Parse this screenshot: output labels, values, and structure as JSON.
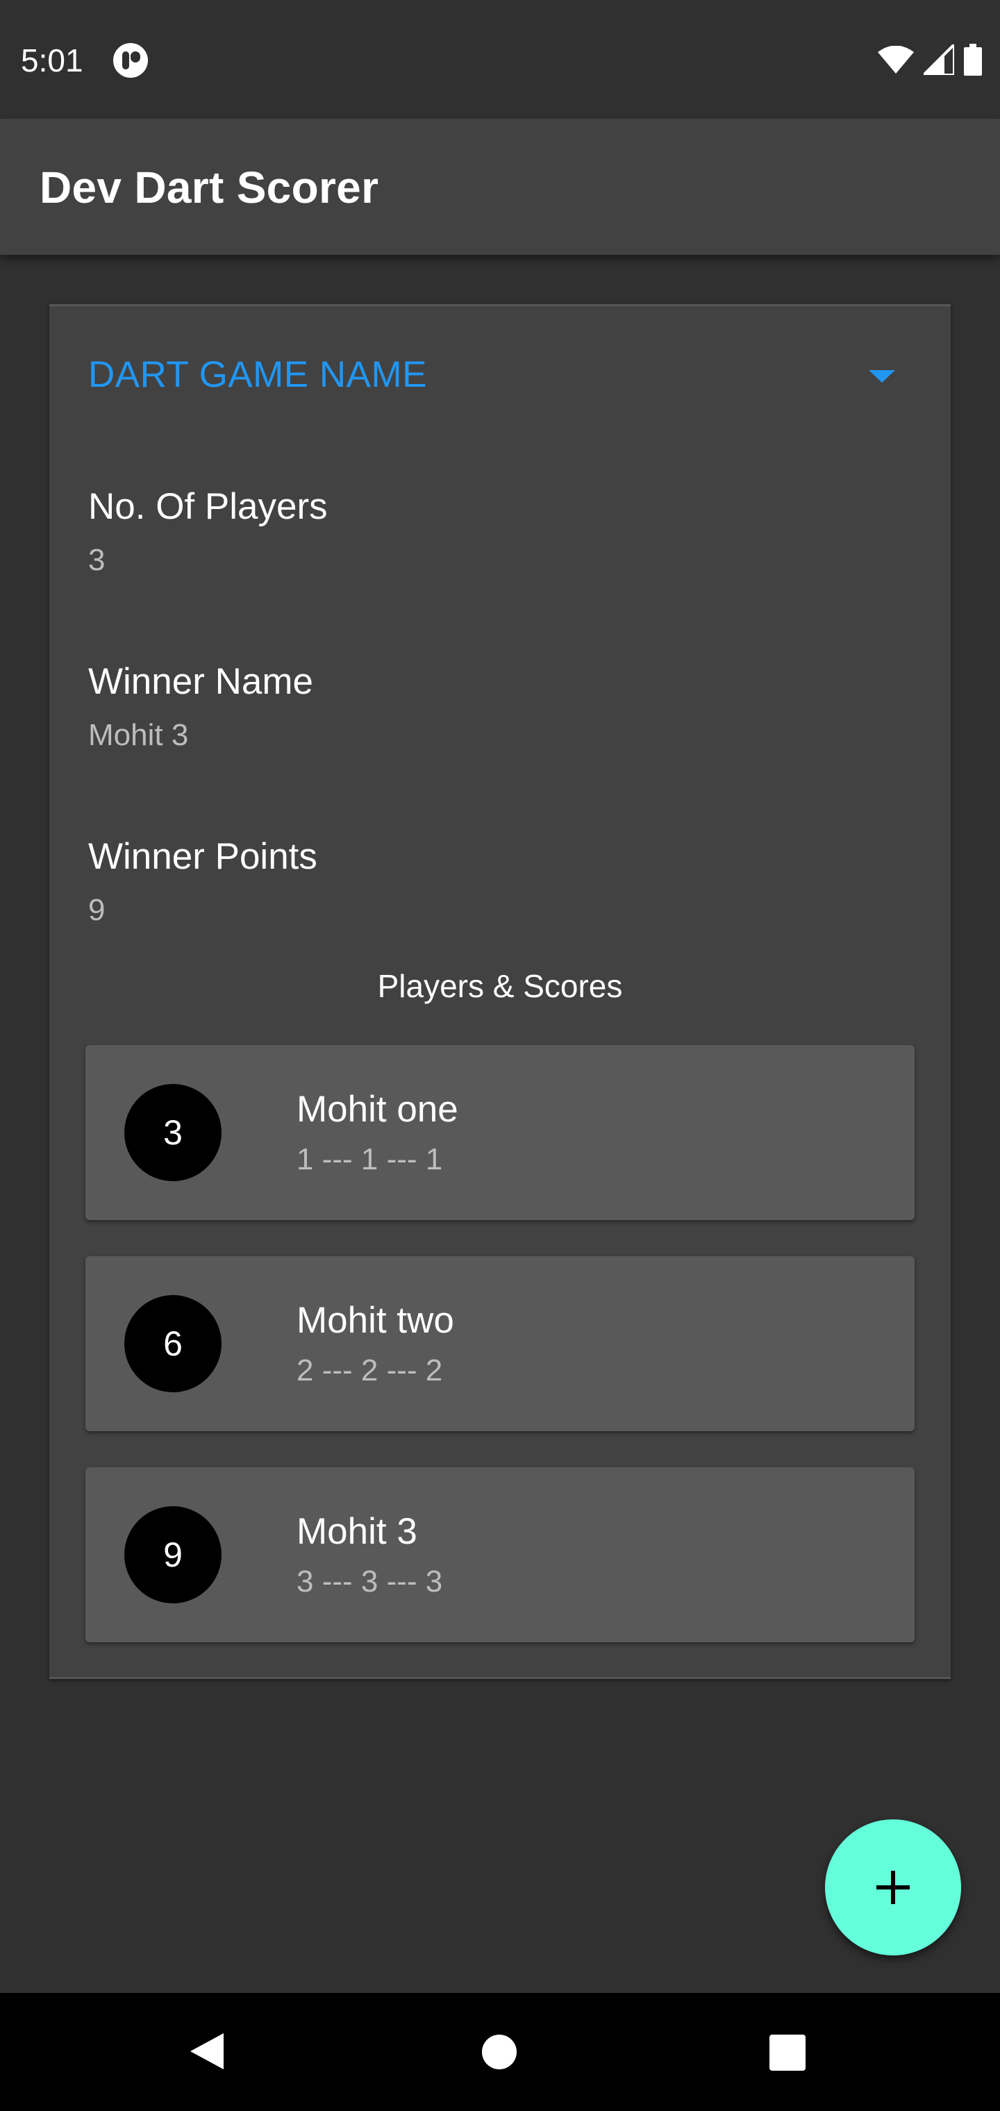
{
  "status_bar": {
    "time": "5:01"
  },
  "app_bar": {
    "title": "Dev Dart Scorer"
  },
  "game": {
    "panel_title": "DART GAME NAME",
    "players_count_label": "No. Of Players",
    "players_count_value": "3",
    "winner_name_label": "Winner Name",
    "winner_name_value": "Mohit 3",
    "winner_points_label": "Winner Points",
    "winner_points_value": "9",
    "players_heading": "Players & Scores",
    "players": [
      {
        "total": "3",
        "name": "Mohit one",
        "scores": "1 --- 1 --- 1"
      },
      {
        "total": "6",
        "name": "Mohit two",
        "scores": "2 --- 2 --- 2"
      },
      {
        "total": "9",
        "name": "Mohit 3",
        "scores": "3 --- 3 --- 3"
      }
    ]
  },
  "colors": {
    "background": "#303030",
    "app_bar": "#424242",
    "accent": "#2196f3",
    "fab": "#64ffda"
  },
  "icons": {
    "status": [
      "app-icon",
      "wifi-icon",
      "cell-signal-icon",
      "battery-icon"
    ],
    "panel": "chevron-down-icon",
    "fab": "plus-icon",
    "nav": [
      "back-icon",
      "home-icon",
      "recents-icon"
    ]
  }
}
